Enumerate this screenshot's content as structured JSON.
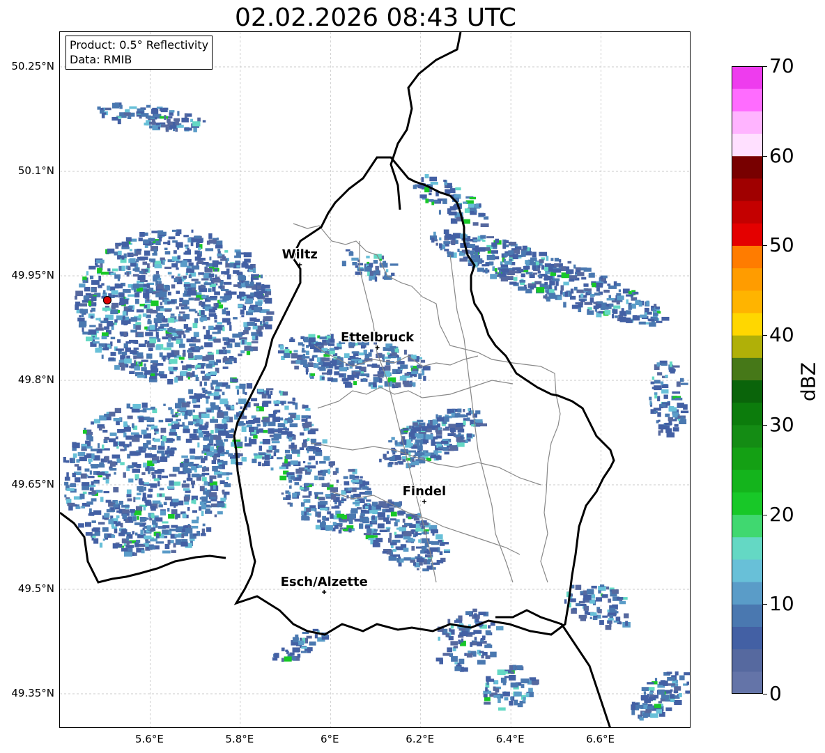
{
  "title": "02.02.2026 08:43 UTC",
  "info_box": {
    "product": "Product: 0.5° Reflectivity",
    "data": "Data: RMIB"
  },
  "map": {
    "lon_range": [
      5.4,
      6.8
    ],
    "lat_range": [
      49.3,
      50.3
    ],
    "lat_ticks": [
      "50.25°N",
      "50.1°N",
      "49.95°N",
      "49.8°N",
      "49.65°N",
      "49.5°N",
      "49.35°N"
    ],
    "lon_ticks": [
      "5.6°E",
      "5.8°E",
      "6°E",
      "6.2°E",
      "6.4°E",
      "6.6°E"
    ],
    "gridlines": true,
    "radar_site": {
      "lon": 5.505,
      "lat": 49.915,
      "color": "#e00000"
    },
    "cities": [
      {
        "name": "Wiltz",
        "lon": 5.932,
        "lat": 49.966
      },
      {
        "name": "Ettelbruck",
        "lon": 6.104,
        "lat": 49.847
      },
      {
        "name": "Findel",
        "lon": 6.208,
        "lat": 49.626
      },
      {
        "name": "Esch/Alzette",
        "lon": 5.986,
        "lat": 49.496
      }
    ]
  },
  "colorbar": {
    "label": "dBZ",
    "min": 0,
    "max": 70,
    "ticks": [
      "0",
      "10",
      "20",
      "30",
      "40",
      "50",
      "60",
      "70"
    ],
    "colors": [
      "#6474a8",
      "#56699f",
      "#4360a4",
      "#4a78b0",
      "#5a9cc8",
      "#68c0d8",
      "#64d8c4",
      "#40d870",
      "#18c828",
      "#14b41c",
      "#14a014",
      "#148c14",
      "#0c7c0c",
      "#0a640a",
      "#467818",
      "#b0b008",
      "#ffd700",
      "#ffb400",
      "#ff9c00",
      "#ff7c00",
      "#e40000",
      "#c40000",
      "#a00000",
      "#780000",
      "#ffe0ff",
      "#ffb4ff",
      "#ff6cff",
      "#ee3cee"
    ]
  }
}
